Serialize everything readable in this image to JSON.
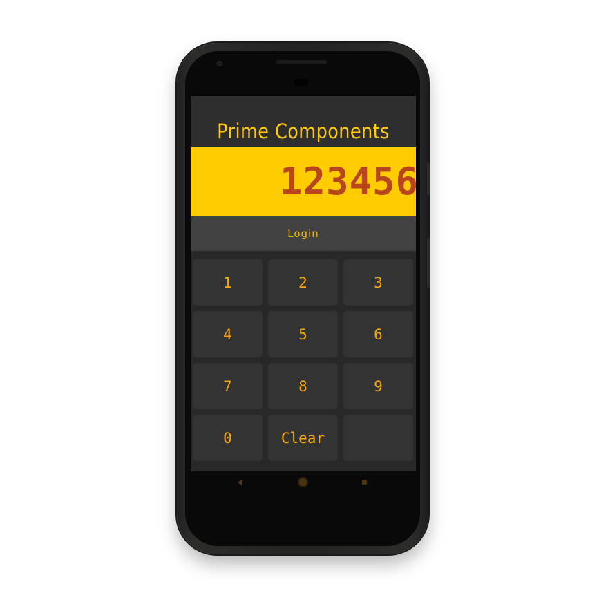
{
  "app": {
    "title": "Prime Components"
  },
  "display": {
    "value": "123456"
  },
  "login": {
    "label": "Login"
  },
  "keypad": {
    "keys": [
      "1",
      "2",
      "3",
      "4",
      "5",
      "6",
      "7",
      "8",
      "9",
      "0",
      "Clear",
      ""
    ]
  },
  "navbar": {
    "icons": [
      "back-icon",
      "home-icon",
      "recent-apps-icon"
    ]
  },
  "colors": {
    "accent": "#ffcb05",
    "display_bg": "#ffcc00",
    "display_text": "#b8451c",
    "key_text": "#f5a80c",
    "screen_bg": "#2e2e2e"
  }
}
